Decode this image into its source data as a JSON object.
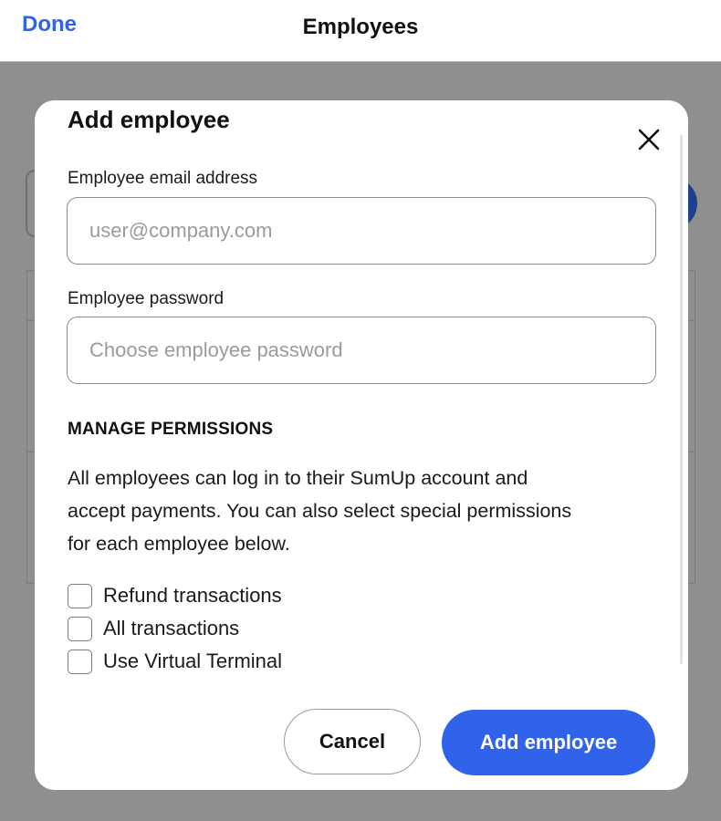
{
  "nav": {
    "done_label": "Done",
    "title": "Employees"
  },
  "modal": {
    "title": "Add employee",
    "email": {
      "label": "Employee email address",
      "placeholder": "user@company.com",
      "value": ""
    },
    "password": {
      "label": "Employee password",
      "placeholder": "Choose employee password",
      "value": ""
    },
    "permissions": {
      "heading": "MANAGE PERMISSIONS",
      "description_lines": [
        "All employees can log in to their SumUp account and",
        "accept payments. You can also select special permissions",
        "for each employee below."
      ],
      "options": [
        {
          "label": "Refund transactions",
          "checked": false
        },
        {
          "label": "All transactions",
          "checked": false
        },
        {
          "label": "Use Virtual Terminal",
          "checked": false
        }
      ]
    },
    "cancel_label": "Cancel",
    "submit_label": "Add employee"
  },
  "colors": {
    "accent": "#3063e9",
    "overlay": "#8f8f8f"
  }
}
